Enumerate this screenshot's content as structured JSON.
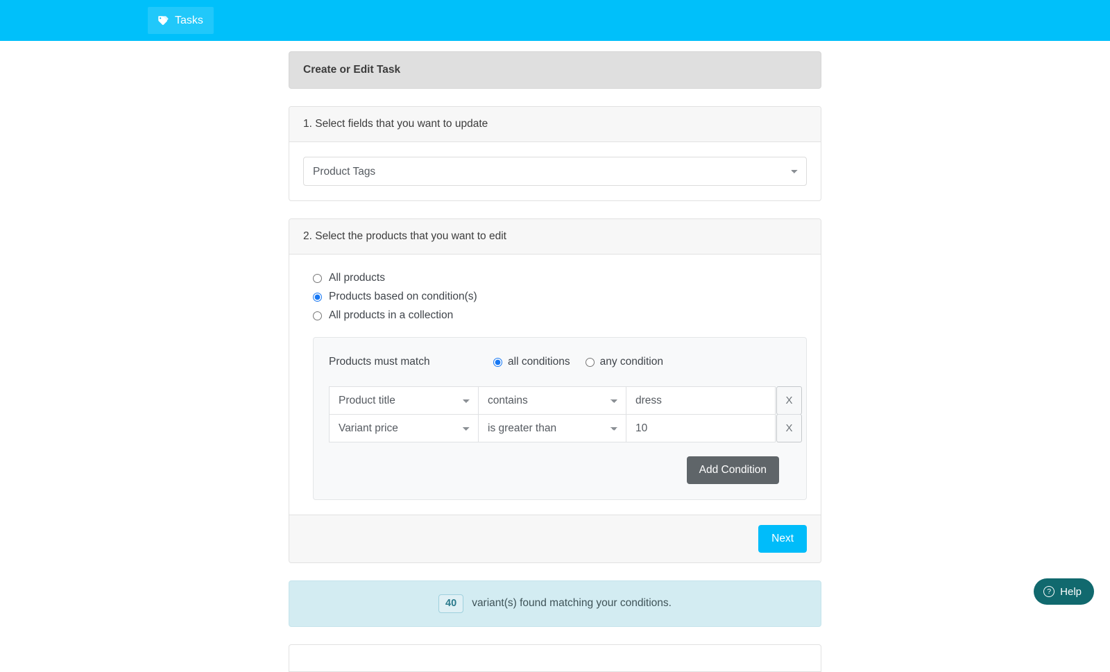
{
  "topbar": {
    "background": "#00c0fa",
    "tab_label": "Tasks",
    "tab_icon": "tag-icon"
  },
  "card": {
    "title": "Create or Edit Task"
  },
  "step1": {
    "heading": "1. Select fields that you want to update",
    "field_select": {
      "value": "Product Tags",
      "options": [
        "Product Tags"
      ]
    }
  },
  "step2": {
    "heading": "2. Select the products that you want to edit",
    "scope_options": [
      {
        "label": "All products",
        "selected": false
      },
      {
        "label": "Products based on condition(s)",
        "selected": true
      },
      {
        "label": "All products in a collection",
        "selected": false
      }
    ],
    "match": {
      "label": "Products must match",
      "options": [
        {
          "label": "all conditions",
          "selected": true
        },
        {
          "label": "any condition",
          "selected": false
        }
      ]
    },
    "conditions": [
      {
        "field": "Product title",
        "operator": "contains",
        "value": "dress",
        "remove_label": "X"
      },
      {
        "field": "Variant price",
        "operator": "is greater than",
        "value": "10",
        "remove_label": "X"
      }
    ],
    "field_options": [
      "Product title",
      "Variant price"
    ],
    "operator_options": [
      "contains",
      "is greater than"
    ],
    "add_condition_label": "Add Condition",
    "next_label": "Next"
  },
  "alert": {
    "count": "40",
    "text": "variant(s) found matching your conditions."
  },
  "help": {
    "label": "Help",
    "icon": "question-circle-icon",
    "background": "#11696e"
  }
}
